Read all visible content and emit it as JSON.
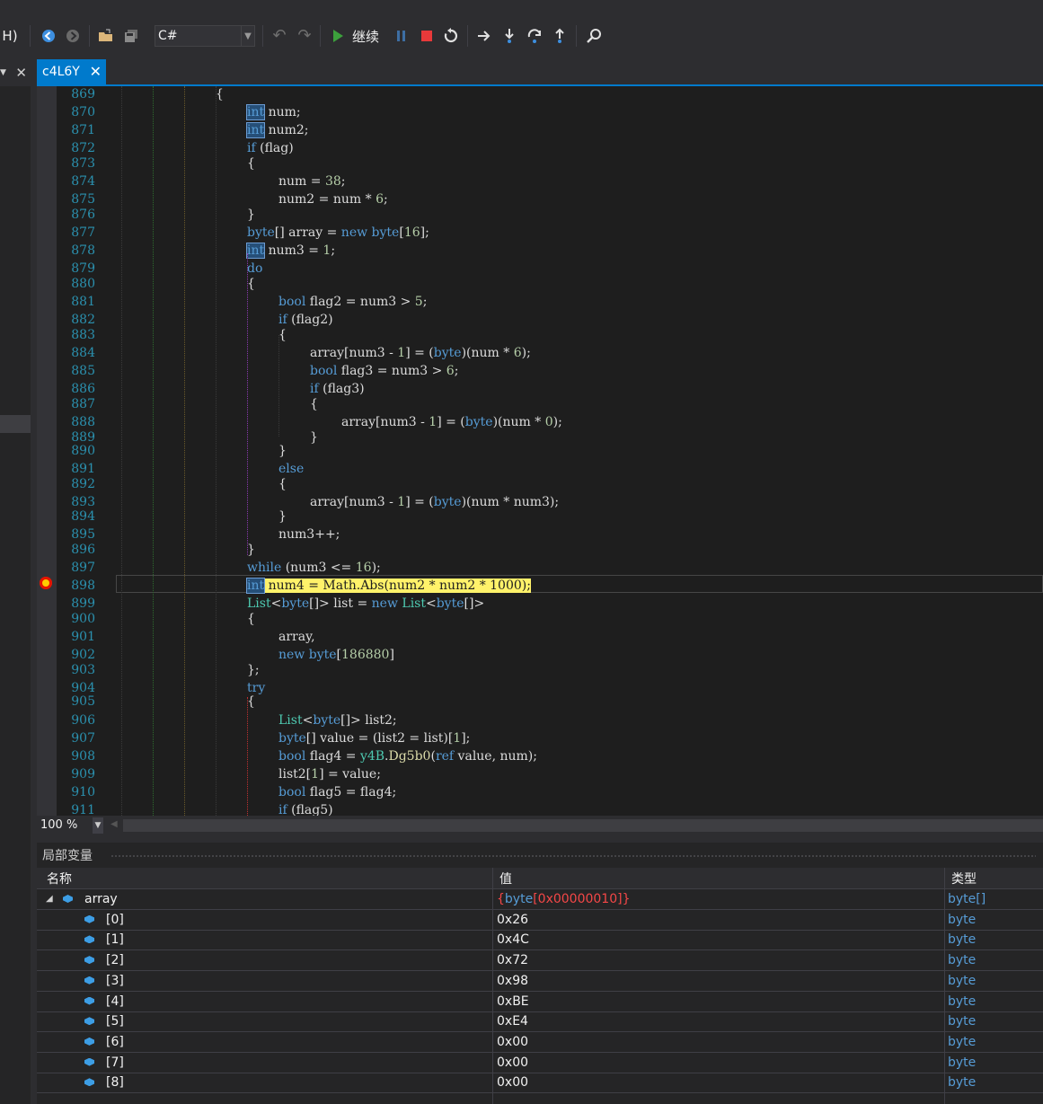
{
  "toolbar": {
    "menu_fragment": "H)",
    "language": "C#",
    "continue_label": "继续",
    "icons": [
      "back-icon",
      "forward-icon",
      "open-folder-icon",
      "save-all-icon",
      "undo-icon",
      "redo-icon",
      "continue-play-icon",
      "pause-icon",
      "stop-icon",
      "restart-icon",
      "show-next-statement-icon",
      "step-into-icon",
      "step-over-icon",
      "step-out-icon",
      "find-icon"
    ]
  },
  "tab": {
    "title": "c4L6Y",
    "close": "✕"
  },
  "left_close": "✕",
  "editor": {
    "zoom": "100 %",
    "current_line": "898",
    "lines": [
      {
        "n": "869",
        "c": "{"
      },
      {
        "n": "870",
        "c": "int num;"
      },
      {
        "n": "871",
        "c": "int num2;"
      },
      {
        "n": "872",
        "c": "if (flag)"
      },
      {
        "n": "873",
        "c": "{"
      },
      {
        "n": "874",
        "c": "num = 38;"
      },
      {
        "n": "875",
        "c": "num2 = num * 6;"
      },
      {
        "n": "876",
        "c": "}"
      },
      {
        "n": "877",
        "c": "byte[] array = new byte[16];"
      },
      {
        "n": "878",
        "c": "int num3 = 1;"
      },
      {
        "n": "879",
        "c": "do"
      },
      {
        "n": "880",
        "c": "{"
      },
      {
        "n": "881",
        "c": "bool flag2 = num3 > 5;"
      },
      {
        "n": "882",
        "c": "if (flag2)"
      },
      {
        "n": "883",
        "c": "{"
      },
      {
        "n": "884",
        "c": "array[num3 - 1] = (byte)(num * 6);"
      },
      {
        "n": "885",
        "c": "bool flag3 = num3 > 6;"
      },
      {
        "n": "886",
        "c": "if (flag3)"
      },
      {
        "n": "887",
        "c": "{"
      },
      {
        "n": "888",
        "c": "array[num3 - 1] = (byte)(num * 0);"
      },
      {
        "n": "889",
        "c": "}"
      },
      {
        "n": "890",
        "c": "}"
      },
      {
        "n": "891",
        "c": "else"
      },
      {
        "n": "892",
        "c": "{"
      },
      {
        "n": "893",
        "c": "array[num3 - 1] = (byte)(num * num3);"
      },
      {
        "n": "894",
        "c": "}"
      },
      {
        "n": "895",
        "c": "num3++;"
      },
      {
        "n": "896",
        "c": "}"
      },
      {
        "n": "897",
        "c": "while (num3 <= 16);"
      },
      {
        "n": "898",
        "c": "int num4 = Math.Abs(num2 * num2 * 1000);"
      },
      {
        "n": "899",
        "c": "List<byte[]> list = new List<byte[]>"
      },
      {
        "n": "900",
        "c": "{"
      },
      {
        "n": "901",
        "c": "array,"
      },
      {
        "n": "902",
        "c": "new byte[186880]"
      },
      {
        "n": "903",
        "c": "};"
      },
      {
        "n": "904",
        "c": "try"
      },
      {
        "n": "905",
        "c": "{"
      },
      {
        "n": "906",
        "c": "List<byte[]> list2;"
      },
      {
        "n": "907",
        "c": "byte[] value = (list2 = list)[1];"
      },
      {
        "n": "908",
        "c": "bool flag4 = y4B.Dg5b0(ref value, num);"
      },
      {
        "n": "909",
        "c": "list2[1] = value;"
      },
      {
        "n": "910",
        "c": "bool flag5 = flag4;"
      },
      {
        "n": "911",
        "c": "if (flag5)"
      }
    ]
  },
  "locals": {
    "title": "局部变量",
    "columns": {
      "name": "名称",
      "value": "值",
      "type": "类型"
    },
    "root": {
      "name": "array",
      "value_prefix": "{",
      "value_type": "byte",
      "value_rest": "[0x00000010]}",
      "type": "byte[]"
    },
    "rows": [
      {
        "name": "[0]",
        "value": "0x26",
        "type": "byte"
      },
      {
        "name": "[1]",
        "value": "0x4C",
        "type": "byte"
      },
      {
        "name": "[2]",
        "value": "0x72",
        "type": "byte"
      },
      {
        "name": "[3]",
        "value": "0x98",
        "type": "byte"
      },
      {
        "name": "[4]",
        "value": "0xBE",
        "type": "byte"
      },
      {
        "name": "[5]",
        "value": "0xE4",
        "type": "byte"
      },
      {
        "name": "[6]",
        "value": "0x00",
        "type": "byte"
      },
      {
        "name": "[7]",
        "value": "0x00",
        "type": "byte"
      },
      {
        "name": "[8]",
        "value": "0x00",
        "type": "byte"
      }
    ]
  },
  "colors": {
    "accent": "#007acc",
    "keyword": "#569cd6",
    "type_name": "#4ec9b0",
    "number": "#b5cea8",
    "method": "#dcdcaa",
    "line_number": "#2b91af",
    "exec_highlight": "#fff26a",
    "changed_value": "#f44747"
  }
}
